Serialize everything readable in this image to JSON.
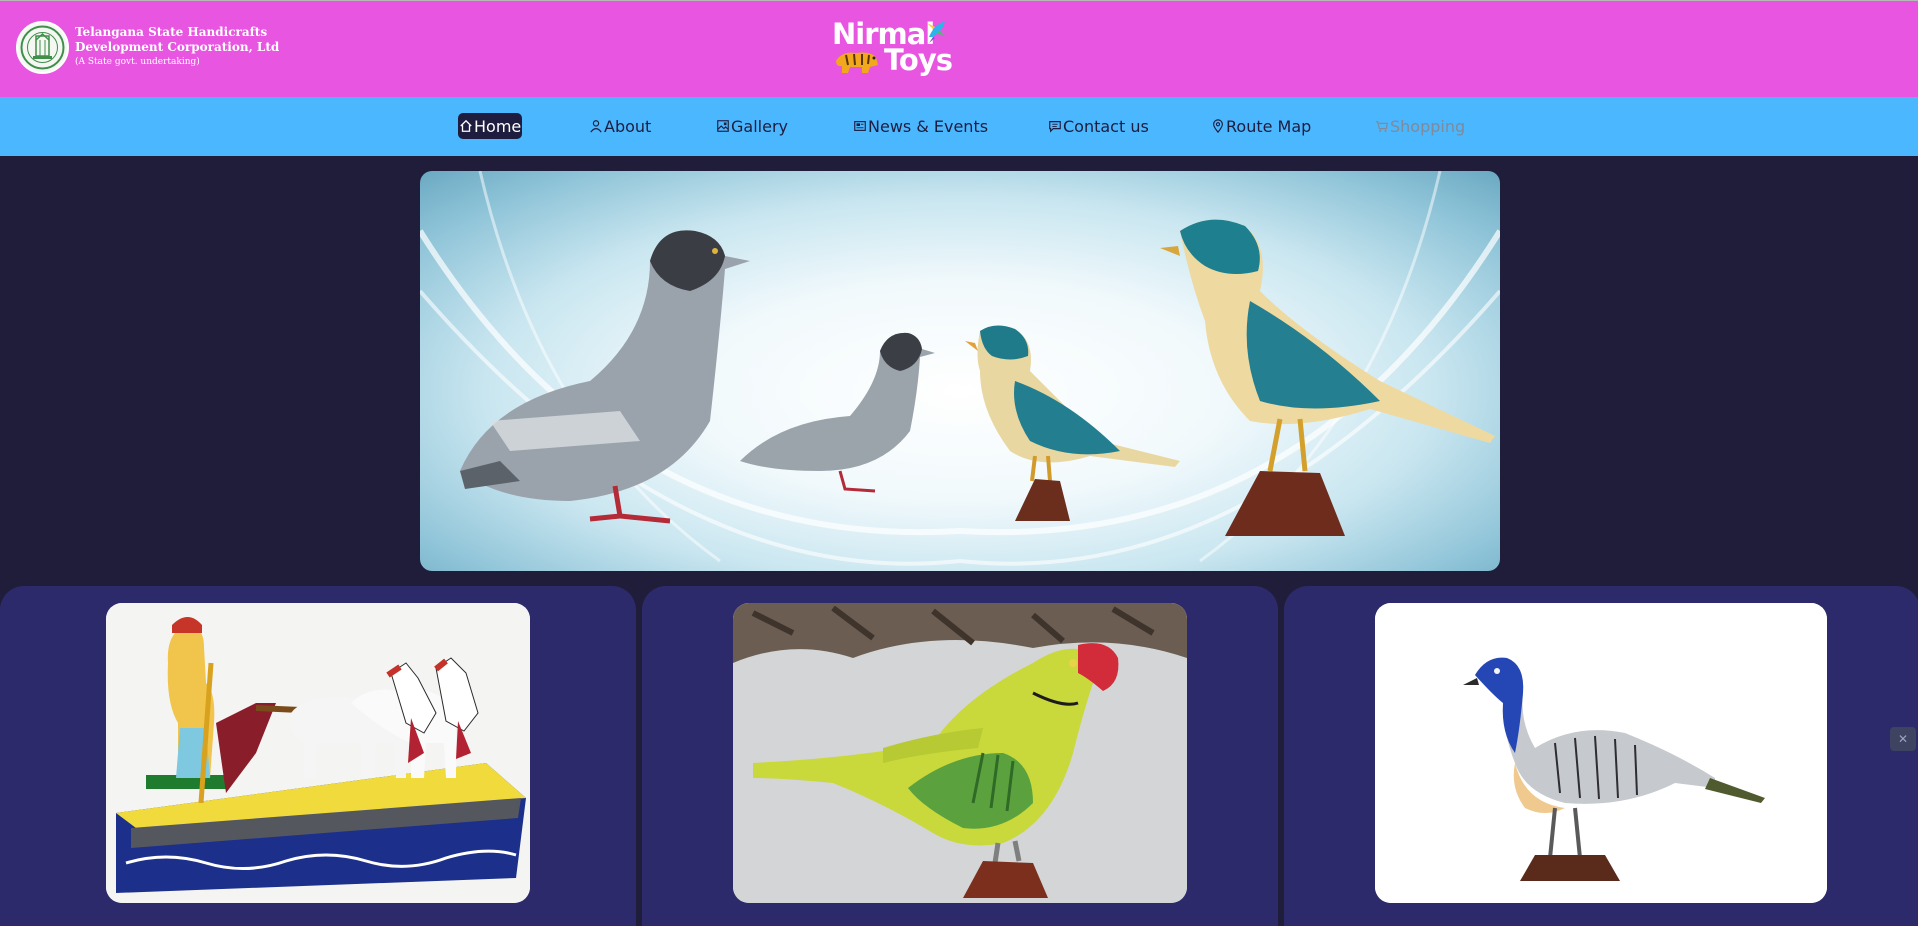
{
  "header": {
    "org_line1": "Telangana State Handicrafts",
    "org_line2": "Development Corporation, Ltd",
    "org_line3": "(A State govt. undertaking)",
    "brand_word1": "Nirmal",
    "brand_word2": "Toys"
  },
  "nav": {
    "items": [
      {
        "label": "Home",
        "icon": "home-icon",
        "state": "active"
      },
      {
        "label": "About",
        "icon": "user-icon",
        "state": "normal"
      },
      {
        "label": "Gallery",
        "icon": "gallery-icon",
        "state": "normal"
      },
      {
        "label": "News & Events",
        "icon": "newspaper-icon",
        "state": "normal"
      },
      {
        "label": "Contact us",
        "icon": "message-icon",
        "state": "normal"
      },
      {
        "label": "Route Map",
        "icon": "map-pin-icon",
        "state": "normal"
      },
      {
        "label": "Shopping",
        "icon": "cart-icon",
        "state": "disabled"
      }
    ]
  },
  "hero": {
    "subject": "painted wooden birds: two pigeons and two kingfishers"
  },
  "cards": [
    {
      "subject": "farmer ploughing with two white bullocks toy"
    },
    {
      "subject": "green parrot toy on wooden stand"
    },
    {
      "subject": "peacock bird toy on wooden stand"
    }
  ],
  "colors": {
    "topbar": "#e855e1",
    "navbar": "#4bb7ff",
    "page_bg": "#201d3b",
    "card_bg": "#2d2a6c",
    "nav_active_bg": "#1f1d3f"
  }
}
